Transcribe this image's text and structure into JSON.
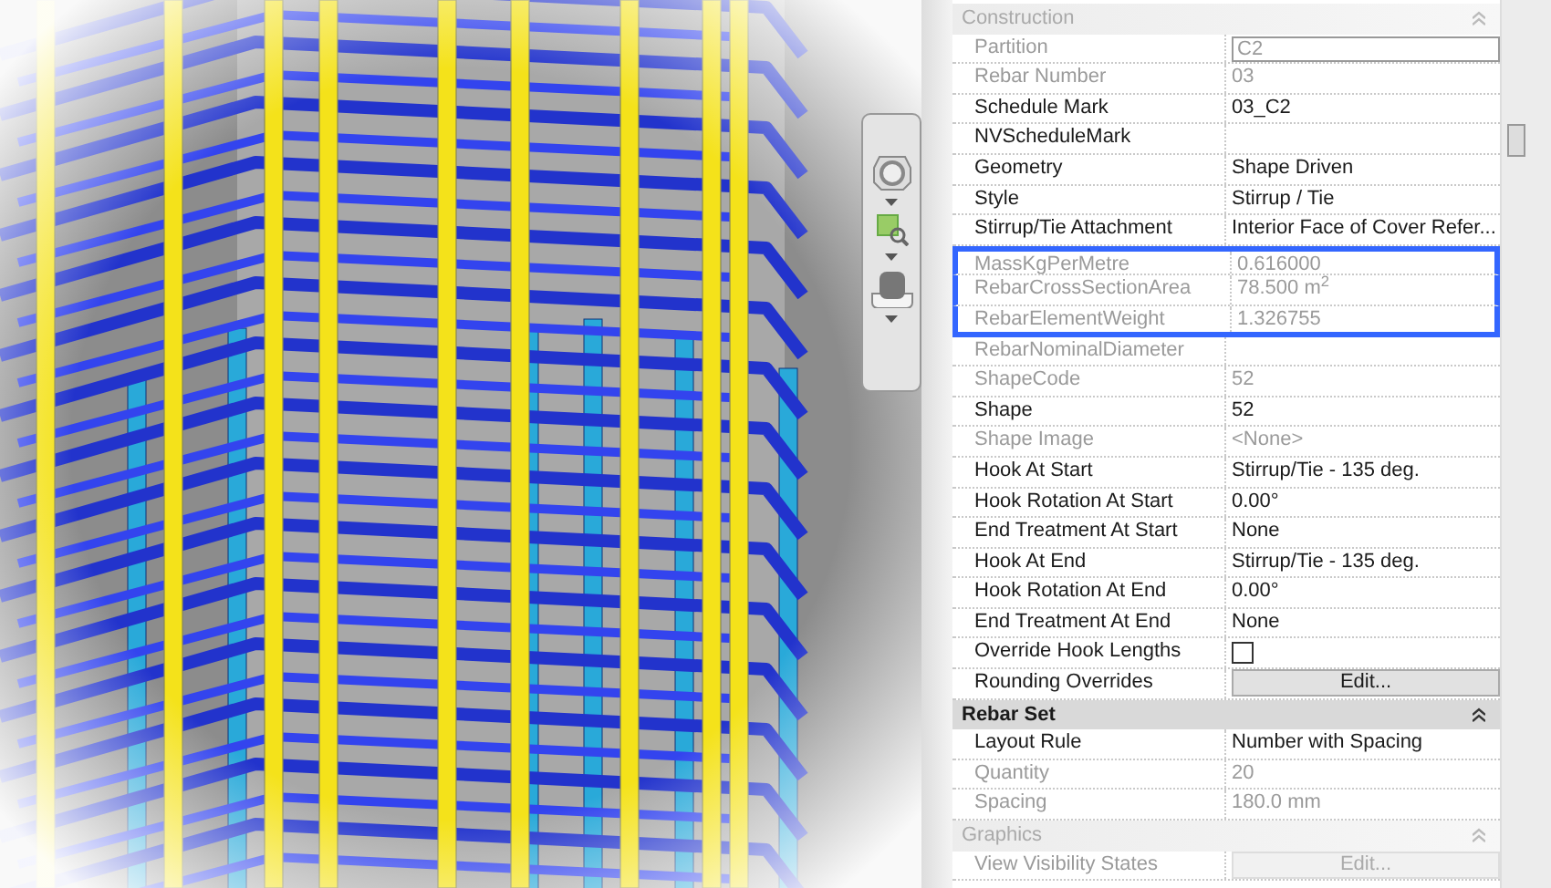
{
  "sections": [
    {
      "title": "Construction",
      "dimmed": true,
      "rows": [
        {
          "label": "Partition",
          "value": "C2",
          "kind": "input",
          "disabled": true,
          "highlighted": false
        },
        {
          "label": "Rebar Number",
          "value": "03",
          "kind": "text",
          "disabled": true,
          "highlighted": false
        },
        {
          "label": "Schedule Mark",
          "value": "03_C2",
          "kind": "text",
          "disabled": false,
          "highlighted": false
        },
        {
          "label": "NVScheduleMark",
          "kind": "text",
          "disabled": false,
          "highlighted": false
        },
        {
          "label": "Geometry",
          "value": "Shape Driven",
          "kind": "text",
          "disabled": false,
          "highlighted": false
        },
        {
          "label": "Style",
          "value": "Stirrup / Tie",
          "kind": "text",
          "disabled": false,
          "highlighted": false
        },
        {
          "label": "Stirrup/Tie Attachment",
          "value": "Interior Face of Cover Refer...",
          "kind": "text",
          "disabled": false,
          "highlighted": false
        },
        {
          "label": "MassKgPerMetre",
          "value": "0.616000",
          "kind": "text",
          "disabled": true,
          "highlighted": true
        },
        {
          "label": "RebarCrossSectionArea",
          "value": "78.500 m$^{2}$",
          "kind": "text",
          "disabled": true,
          "highlighted": true
        },
        {
          "label": "RebarElementWeight",
          "value": "1.326755",
          "kind": "text",
          "disabled": true,
          "highlighted": true
        },
        {
          "label": "RebarNominalDiameter",
          "kind": "text",
          "disabled": true,
          "highlighted": false
        },
        {
          "label": "ShapeCode",
          "value": "52",
          "kind": "text",
          "disabled": true,
          "highlighted": false
        },
        {
          "label": "Shape",
          "value": "52",
          "kind": "text",
          "disabled": false,
          "highlighted": false
        },
        {
          "label": "Shape Image",
          "value": "<None>",
          "kind": "text",
          "disabled": true,
          "highlighted": false
        },
        {
          "label": "Hook At Start",
          "value": "Stirrup/Tie - 135 deg.",
          "kind": "text",
          "disabled": false,
          "highlighted": false
        },
        {
          "label": "Hook Rotation At Start",
          "value": "0.00°",
          "kind": "text",
          "disabled": false,
          "highlighted": false
        },
        {
          "label": "End Treatment At Start",
          "value": "None",
          "kind": "text",
          "disabled": false,
          "highlighted": false
        },
        {
          "label": "Hook At End",
          "value": "Stirrup/Tie - 135 deg.",
          "kind": "text",
          "disabled": false,
          "highlighted": false
        },
        {
          "label": "Hook Rotation At End",
          "value": "0.00°",
          "kind": "text",
          "disabled": false,
          "highlighted": false
        },
        {
          "label": "End Treatment At End",
          "value": "None",
          "kind": "text",
          "disabled": false,
          "highlighted": false
        },
        {
          "label": "Override Hook Lengths",
          "kind": "checkbox",
          "checked": false,
          "disabled": false,
          "highlighted": false
        },
        {
          "label": "Rounding Overrides",
          "value": "Edit...",
          "kind": "button",
          "disabled": false,
          "highlighted": false
        }
      ]
    },
    {
      "title": "Rebar Set",
      "dimmed": false,
      "rows": [
        {
          "label": "Layout Rule",
          "value": "Number with Spacing",
          "kind": "text",
          "disabled": false,
          "highlighted": false
        },
        {
          "label": "Quantity",
          "value": "20",
          "kind": "text",
          "disabled": true,
          "highlighted": false
        },
        {
          "label": "Spacing",
          "value": "180.0 mm",
          "kind": "text",
          "disabled": true,
          "highlighted": false
        }
      ]
    },
    {
      "title": "Graphics",
      "dimmed": true,
      "rows": [
        {
          "label": "View Visibility States",
          "value": "Edit...",
          "kind": "button",
          "disabled": true,
          "highlighted": false
        }
      ]
    }
  ]
}
